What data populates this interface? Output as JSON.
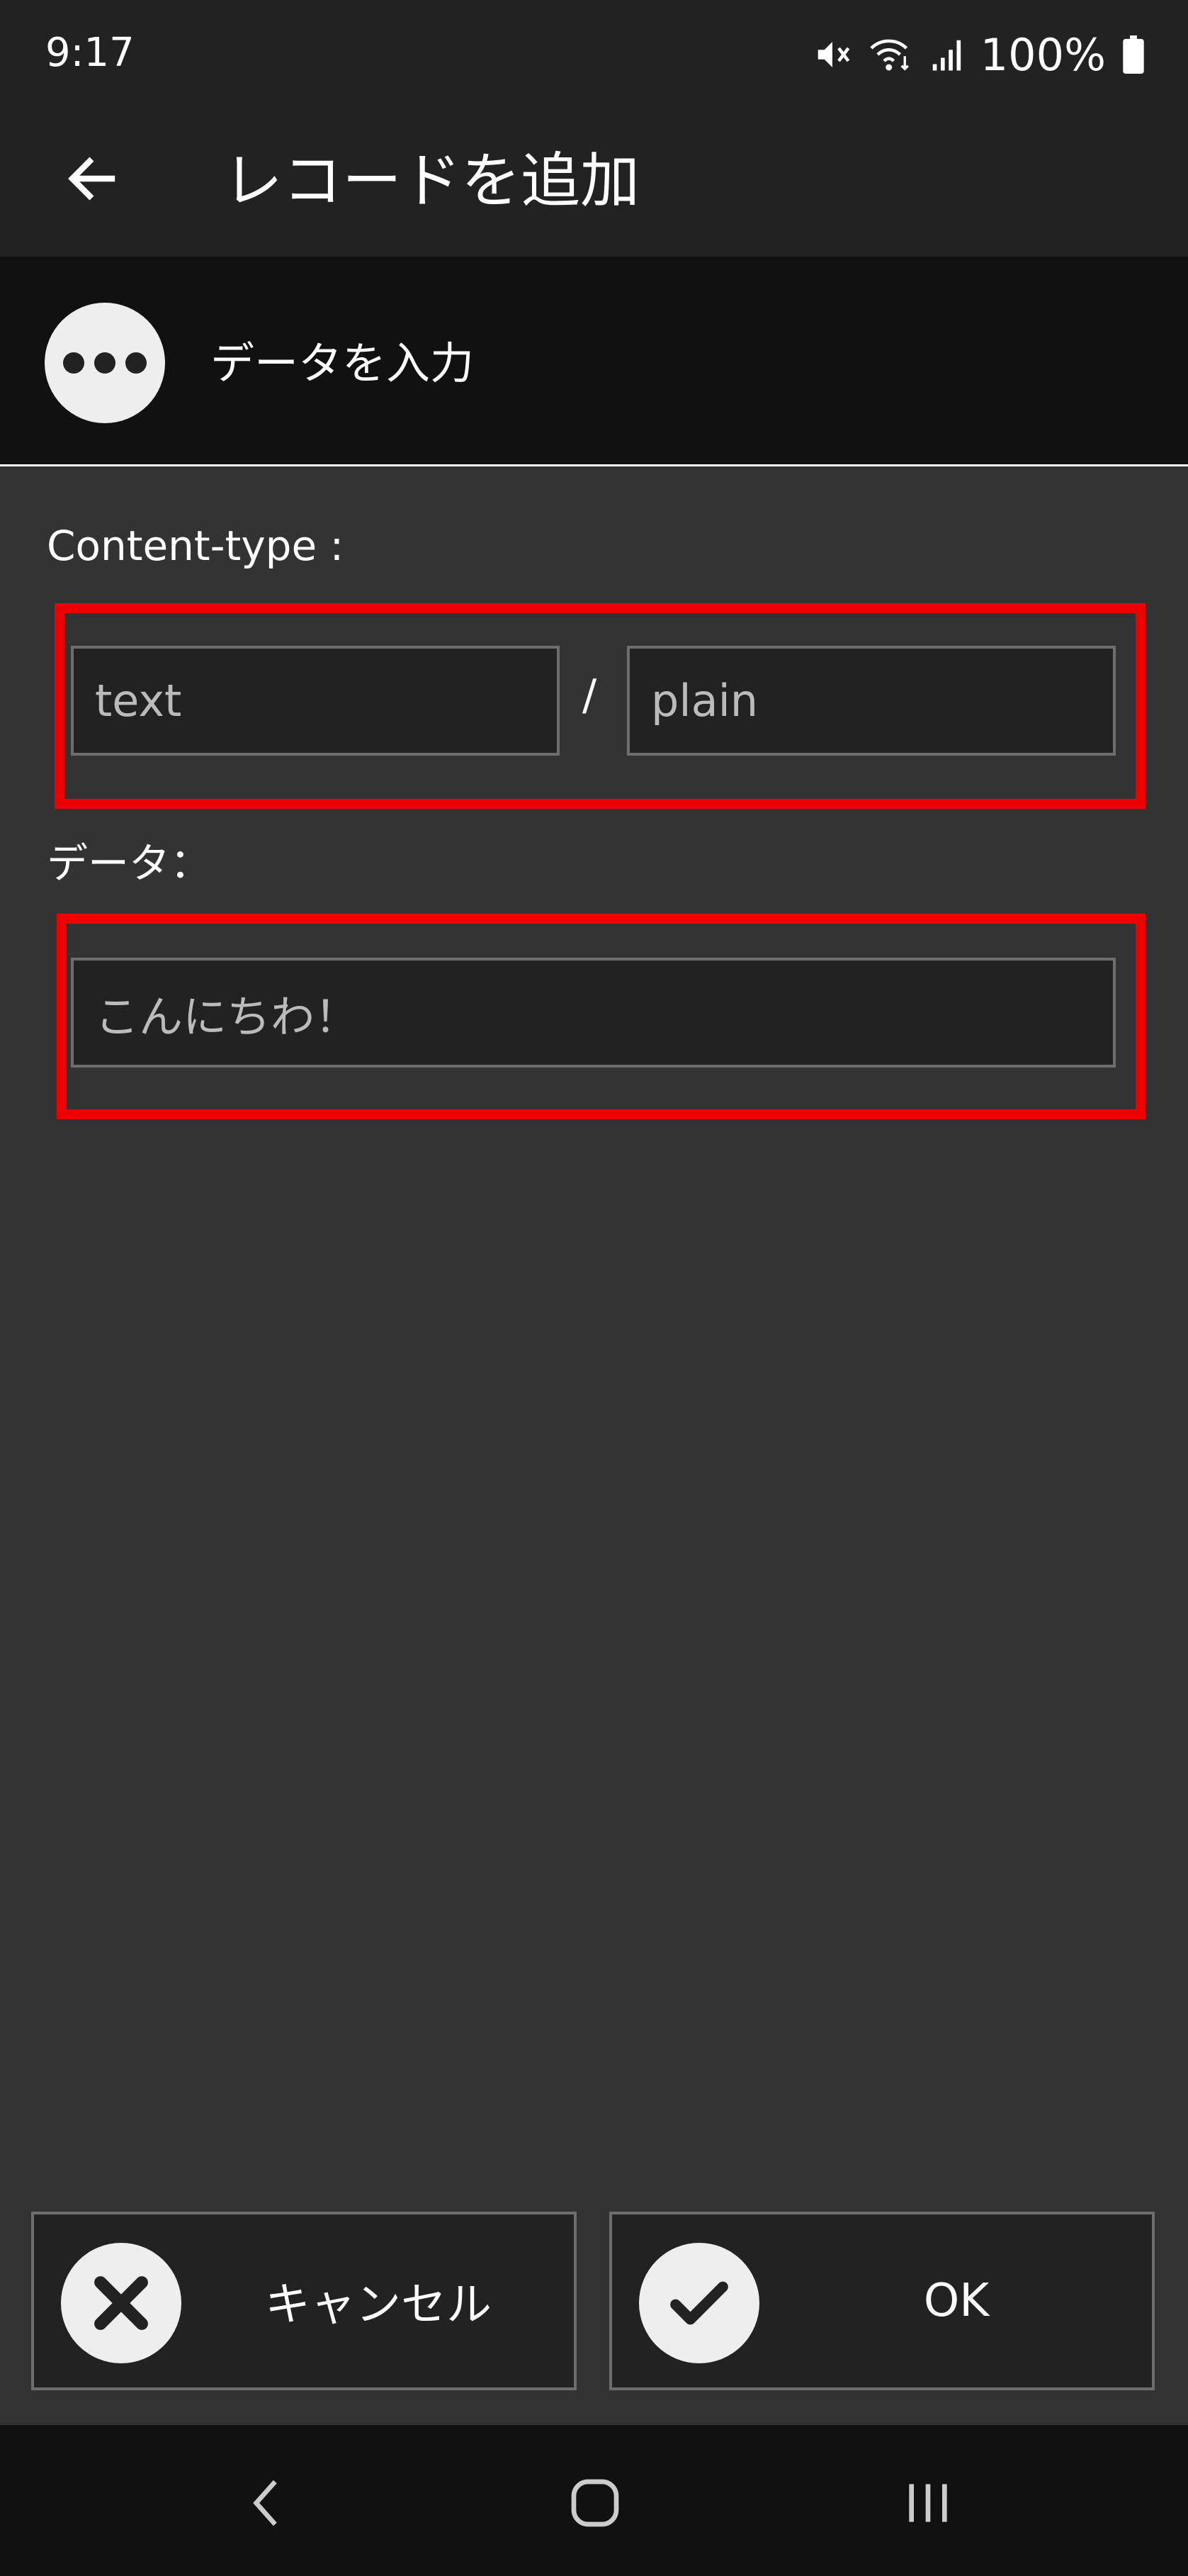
{
  "status_bar": {
    "time": "9:17",
    "battery": "100%",
    "icons": [
      "mute-icon",
      "wifi-icon",
      "signal-icon",
      "battery-icon"
    ]
  },
  "app_bar": {
    "title": "レコードを追加",
    "back_icon": "arrow-left-icon"
  },
  "sub_header": {
    "icon": "more-horizontal-icon",
    "title": "データを入力"
  },
  "form": {
    "content_type_label": "Content-type :",
    "type_value": "text",
    "separator": "/",
    "subtype_value": "plain",
    "data_label": "データ：",
    "data_value": "こんにちわ！"
  },
  "buttons": {
    "cancel_label": "キャンセル",
    "cancel_icon": "close-icon",
    "ok_label": "OK",
    "ok_icon": "check-icon"
  },
  "nav_bar": {
    "icons": [
      "nav-back-icon",
      "nav-home-icon",
      "nav-recents-icon"
    ]
  },
  "colors": {
    "highlight": "#ee0000",
    "background": "#333333",
    "bar": "#222222",
    "input_border": "#6e6e6e"
  }
}
